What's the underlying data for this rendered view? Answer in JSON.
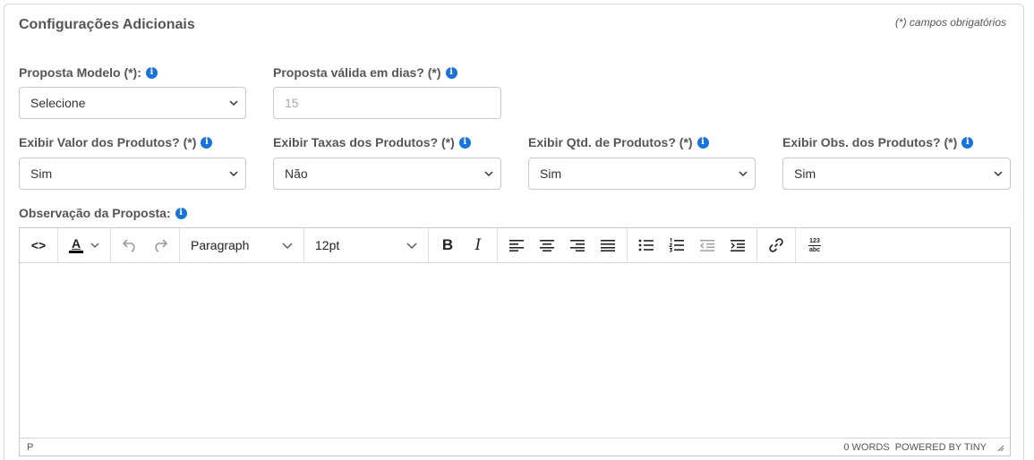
{
  "panel": {
    "title": "Configurações Adicionais",
    "required_note": "(*) campos obrigatórios"
  },
  "fields": {
    "proposta_modelo": {
      "label": "Proposta Modelo (*):",
      "value": "Selecione"
    },
    "proposta_validade": {
      "label": "Proposta válida em dias? (*)",
      "placeholder": "15"
    },
    "exibir_valor": {
      "label": "Exibir Valor dos Produtos? (*)",
      "value": "Sim"
    },
    "exibir_taxas": {
      "label": "Exibir Taxas dos Produtos? (*)",
      "value": "Não"
    },
    "exibir_qtd": {
      "label": "Exibir Qtd. de Produtos? (*)",
      "value": "Sim"
    },
    "exibir_obs": {
      "label": "Exibir Obs. dos Produtos? (*)",
      "value": "Sim"
    },
    "observacao": {
      "label": "Observação da Proposta:"
    }
  },
  "info_icon_glyph": "i",
  "editor": {
    "toolbar": {
      "code_glyph": "<>",
      "text_color_glyph": "A",
      "block_format": "Paragraph",
      "font_size": "12pt",
      "bold_glyph": "B",
      "italic_glyph": "I",
      "wordcount_top": "123",
      "wordcount_bottom": "abc"
    },
    "status": {
      "path": "P",
      "word_count": "0 WORDS",
      "powered_by": "POWERED BY TINY"
    }
  },
  "colors": {
    "info_icon": "#1a73d9",
    "border": "#c8c8c8",
    "label": "#555555"
  }
}
